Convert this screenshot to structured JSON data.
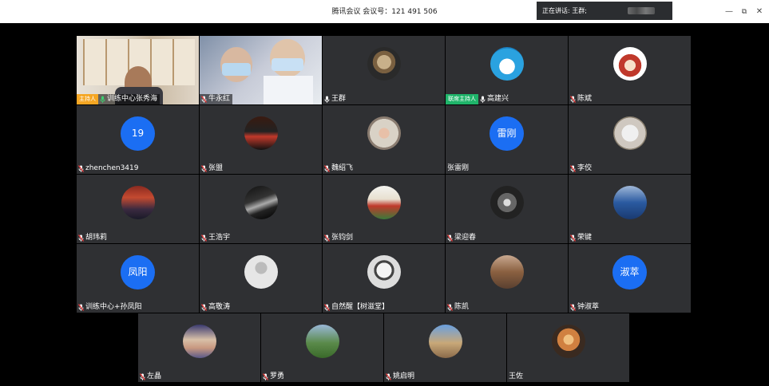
{
  "titlebar": {
    "title": "腾讯会议 会议号：121 491 506",
    "speaking_label": "正在讲话: 王群;"
  },
  "window_controls": [
    {
      "name": "minimize-button",
      "glyph": "—"
    },
    {
      "name": "restore-button",
      "glyph": "⧉"
    },
    {
      "name": "close-button",
      "glyph": "✕"
    }
  ],
  "colors": {
    "tile_bg": "#2f3033",
    "initial_bg": "#1b6ef3",
    "host_badge": "#f5a623",
    "cohost_badge": "#1fb46a",
    "mic_green": "#3cd070",
    "mic_muted": "#e23b3b"
  },
  "participants": [
    {
      "name": "训练中心张秀海",
      "badge": "主持人",
      "badge_type": "host",
      "mic": "on",
      "kind": "video1"
    },
    {
      "name": "牛永红",
      "mic": "muted",
      "kind": "video2"
    },
    {
      "name": "王群",
      "mic": "on-white",
      "kind": "photo",
      "avatar": "cat"
    },
    {
      "name": "高建兴",
      "badge": "联席主持人",
      "badge_type": "cohost",
      "mic": "on-white",
      "kind": "photo",
      "avatar": "doraemon"
    },
    {
      "name": "陈斌",
      "mic": "muted",
      "kind": "photo",
      "avatar": "cartoon-girl"
    },
    {
      "name": "zhenchen3419",
      "mic": "muted",
      "kind": "initial",
      "initial": "19"
    },
    {
      "name": "张盟",
      "mic": "muted",
      "kind": "photo",
      "avatar": "leon"
    },
    {
      "name": "魏绍飞",
      "mic": "muted",
      "kind": "photo",
      "avatar": "kid"
    },
    {
      "name": "张雷刚",
      "mic": "none",
      "kind": "initial",
      "initial": "雷刚"
    },
    {
      "name": "李佼",
      "mic": "muted",
      "kind": "photo",
      "avatar": "white-cat"
    },
    {
      "name": "胡玮莉",
      "mic": "muted",
      "kind": "photo",
      "avatar": "stage"
    },
    {
      "name": "王浩宇",
      "mic": "muted",
      "kind": "photo",
      "avatar": "dark"
    },
    {
      "name": "张钧剑",
      "mic": "muted",
      "kind": "photo",
      "avatar": "runner"
    },
    {
      "name": "梁迎春",
      "mic": "muted",
      "kind": "photo",
      "avatar": "tree"
    },
    {
      "name": "荣键",
      "mic": "muted",
      "kind": "photo",
      "avatar": "blue-jacket"
    },
    {
      "name": "训练中心+孙凤阳",
      "mic": "muted",
      "kind": "initial",
      "initial": "凤阳"
    },
    {
      "name": "高敬涛",
      "mic": "muted",
      "kind": "photo",
      "avatar": "default"
    },
    {
      "name": "自然醒【树滋堂】",
      "mic": "muted",
      "kind": "photo",
      "avatar": "baby"
    },
    {
      "name": "陈凯",
      "mic": "muted",
      "kind": "photo",
      "avatar": "group"
    },
    {
      "name": "钟淑萃",
      "mic": "muted",
      "kind": "initial",
      "initial": "淑萃"
    },
    {
      "name": "左晶",
      "mic": "muted",
      "kind": "photo",
      "avatar": "hat"
    },
    {
      "name": "罗勇",
      "mic": "muted",
      "kind": "photo",
      "avatar": "park"
    },
    {
      "name": "姚启明",
      "mic": "muted",
      "kind": "photo",
      "avatar": "palace"
    },
    {
      "name": "王佐",
      "mic": "none",
      "kind": "photo",
      "avatar": "sunset"
    }
  ]
}
